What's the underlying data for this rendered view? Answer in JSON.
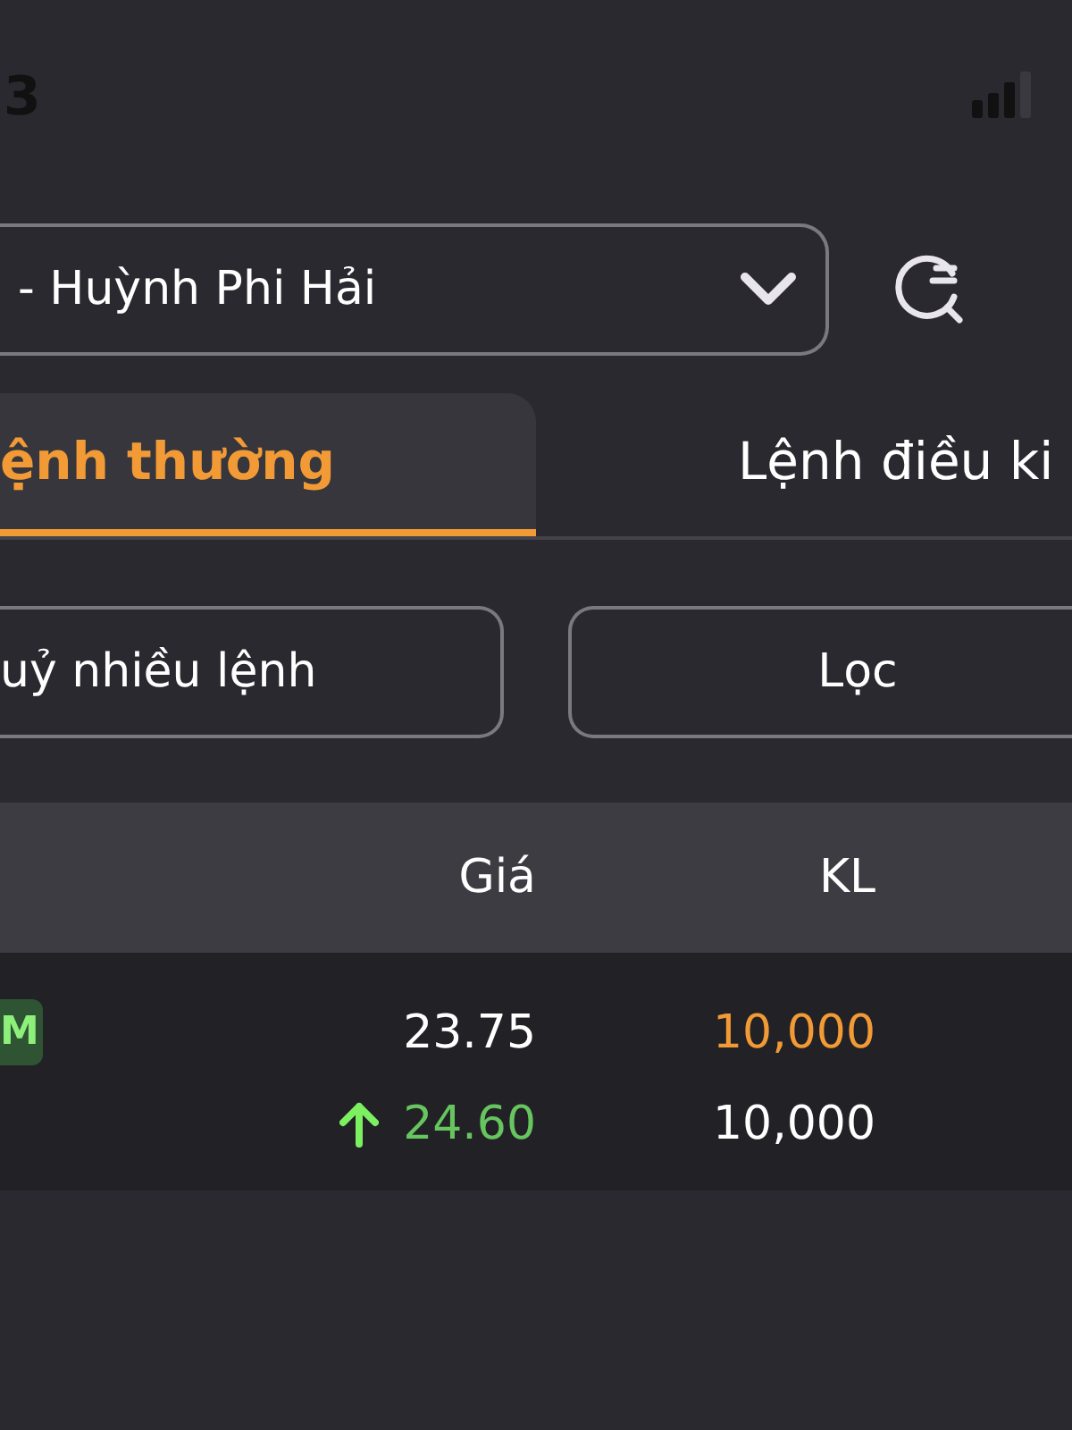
{
  "status_bar": {
    "time": "3"
  },
  "account_select": {
    "value": "- Huỳnh Phi Hải"
  },
  "tabs": [
    {
      "label": "ệnh thường",
      "selected": true
    },
    {
      "label": "Lệnh điều ki",
      "selected": false
    }
  ],
  "buttons": [
    {
      "label": "uỷ nhiều lệnh"
    },
    {
      "label": "Lọc"
    }
  ],
  "table": {
    "columns": [
      "Giá",
      "KL"
    ],
    "rows": [
      {
        "badge": "M",
        "lines": [
          {
            "kind": "order",
            "price": "23.75",
            "volume": "10,000"
          },
          {
            "kind": "match",
            "rising": true,
            "price": "24.60",
            "volume": "10,000"
          }
        ]
      }
    ]
  }
}
